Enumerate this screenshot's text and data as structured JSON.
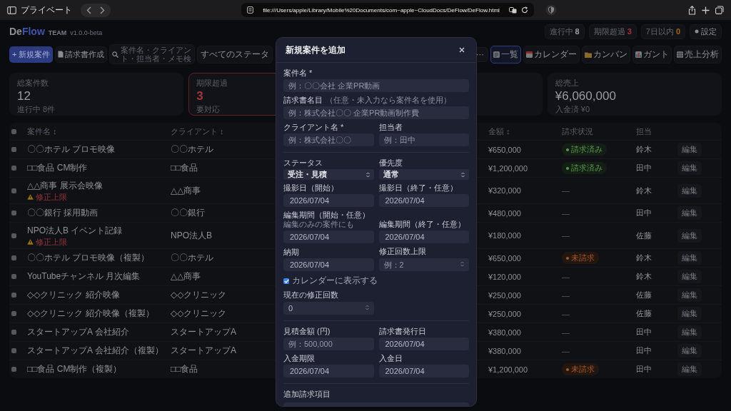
{
  "browser": {
    "private_label": "プライベート",
    "url": "file:///Users/apple/Library/Mobile%20Documents/com~apple~CloudDocs/DeFlow/DeFlow.html"
  },
  "header": {
    "logo_first": "De",
    "logo_second": "Flow",
    "team": "TEAM",
    "version": "v1.0.0-beta",
    "chips": [
      {
        "label": "進行中",
        "count": "8",
        "color": "#9a9ca2"
      },
      {
        "label": "期限超過",
        "count": "3",
        "color": "#a3353a"
      },
      {
        "label": "7日以内",
        "count": "0",
        "color": "#a06a14"
      }
    ],
    "settings": "設定"
  },
  "toolbar": {
    "new_button": "+ 新規案件",
    "invoice_button": "請求書作成",
    "search": {
      "placeholder": "案件名・クライアント・担当者・メモ検"
    },
    "status_select": "すべてのステータ",
    "more": "⋯",
    "views": [
      {
        "kind": "list",
        "label": "一覧",
        "selected": true
      },
      {
        "kind": "calendar",
        "label": "カレンダー",
        "selected": false
      },
      {
        "kind": "kanban",
        "label": "カンバン",
        "selected": false
      },
      {
        "kind": "gantt",
        "label": "ガント",
        "selected": false
      },
      {
        "kind": "sales",
        "label": "売上分析",
        "selected": false
      }
    ]
  },
  "stats": [
    {
      "label": "総案件数",
      "value": "12",
      "sub": "進行中 8件",
      "alert": false
    },
    {
      "label": "期限超過",
      "value": "3",
      "sub": "要対応",
      "alert": true
    },
    {
      "alert": false
    },
    {
      "label": "総売上",
      "value": "¥6,060,000",
      "sub": "入金済 ¥0",
      "alert": false
    }
  ],
  "table": {
    "header_checked": false,
    "columns": [
      {
        "label": "案件名",
        "sort": "↕"
      },
      {
        "label": "クライアント",
        "sort": "↕"
      },
      {
        "label": "金額",
        "sort": "↕"
      },
      {
        "label": "請求状況"
      },
      {
        "label": "担当"
      }
    ],
    "rows": [
      {
        "checked": false,
        "name": "〇〇ホテル プロモ映像",
        "client": "〇〇ホテル",
        "amount": "¥650,000",
        "billing": {
          "kind": "billed",
          "label": "請求済み"
        },
        "assignee": "鈴木",
        "edit": "編集"
      },
      {
        "checked": false,
        "name": "□□食品 CM制作",
        "client": "□□食品",
        "amount": "¥1,200,000",
        "billing": {
          "kind": "billed",
          "label": "請求済み"
        },
        "assignee": "田中",
        "edit": "編集"
      },
      {
        "checked": false,
        "name": "△△商事 展示会映像",
        "warning": "修正上限",
        "client": "△△商事",
        "amount": "¥320,000",
        "billing": {
          "kind": "none",
          "label": "—"
        },
        "assignee": "鈴木",
        "edit": "編集"
      },
      {
        "checked": false,
        "name": "〇〇銀行 採用動画",
        "client": "〇〇銀行",
        "amount": "¥480,000",
        "billing": {
          "kind": "none",
          "label": "—"
        },
        "assignee": "田中",
        "edit": "編集"
      },
      {
        "checked": false,
        "name": "NPO法人B イベント記録",
        "warning": "修正上限",
        "client": "NPO法人B",
        "amount": "¥180,000",
        "billing": {
          "kind": "none",
          "label": "—"
        },
        "assignee": "佐藤",
        "edit": "編集"
      },
      {
        "checked": false,
        "name": "〇〇ホテル プロモ映像（複製）",
        "client": "〇〇ホテル",
        "amount": "¥650,000",
        "billing": {
          "kind": "unbilled",
          "label": "未請求"
        },
        "assignee": "鈴木",
        "edit": "編集"
      },
      {
        "checked": false,
        "name": "YouTubeチャンネル 月次編集",
        "client": "△△商事",
        "amount": "¥120,000",
        "billing": {
          "kind": "none",
          "label": "—"
        },
        "assignee": "鈴木",
        "edit": "編集"
      },
      {
        "checked": false,
        "name": "◇◇クリニック 紹介映像",
        "client": "◇◇クリニック",
        "amount": "¥250,000",
        "billing": {
          "kind": "none",
          "label": "—"
        },
        "assignee": "佐藤",
        "edit": "編集"
      },
      {
        "checked": false,
        "name": "◇◇クリニック 紹介映像（複製）",
        "client": "◇◇クリニック",
        "amount": "¥250,000",
        "billing": {
          "kind": "none",
          "label": "—"
        },
        "assignee": "佐藤",
        "edit": "編集"
      },
      {
        "checked": false,
        "name": "スタートアップA 会社紹介",
        "client": "スタートアップA",
        "amount": "¥380,000",
        "billing": {
          "kind": "none",
          "label": "—"
        },
        "assignee": "田中",
        "edit": "編集"
      },
      {
        "checked": false,
        "name": "スタートアップA 会社紹介（複製）",
        "client": "スタートアップA",
        "amount": "¥380,000",
        "billing": {
          "kind": "none",
          "label": "—"
        },
        "assignee": "田中",
        "edit": "編集"
      },
      {
        "checked": false,
        "name": "□□食品 CM制作（複製）",
        "client": "□□食品",
        "amount": "¥1,200,000",
        "billing": {
          "kind": "unbilled",
          "label": "未請求"
        },
        "assignee": "田中",
        "edit": "編集"
      }
    ]
  },
  "modal": {
    "title": "新規案件を追加",
    "items": [
      {
        "kind": "wide_row",
        "fields": [
          {
            "kind": "text",
            "label": "案件名 *",
            "placeholder": "例：〇〇会社 企業PR動画"
          }
        ]
      },
      {
        "kind": "wide_row",
        "fields": [
          {
            "kind": "text",
            "label": "請求書名目",
            "note": "（任意・未入力なら案件名を使用）",
            "placeholder": "例：株式会社〇〇 企業PR動画制作費"
          }
        ]
      },
      {
        "kind": "row",
        "fields": [
          {
            "kind": "text",
            "label": "クライアント名 *",
            "placeholder": "例：株式会社〇〇"
          },
          {
            "kind": "text",
            "label": "担当者",
            "placeholder": "例：田中"
          }
        ]
      },
      {
        "kind": "divider"
      },
      {
        "kind": "row",
        "fields": [
          {
            "kind": "select",
            "label": "ステータス",
            "value": "受注・見積"
          },
          {
            "kind": "select",
            "label": "優先度",
            "value": "通常"
          }
        ]
      },
      {
        "kind": "row",
        "fields": [
          {
            "kind": "date",
            "label": "撮影日（開始）",
            "value": "2026/07/04"
          },
          {
            "kind": "date",
            "label": "撮影日（終了・任意）",
            "value": "2026/07/04"
          }
        ]
      },
      {
        "kind": "row",
        "fields": [
          {
            "kind": "date",
            "label": "編集期間（開始・任意）",
            "note": "編集のみの案件にも",
            "value": "2026/07/04"
          },
          {
            "kind": "date",
            "label": "編集期間（終了・任意）",
            "value": "2026/07/04"
          }
        ]
      },
      {
        "kind": "row",
        "fields": [
          {
            "kind": "date",
            "label": "納期",
            "value": "2026/07/04"
          },
          {
            "kind": "number",
            "label": "修正回数上限",
            "placeholder": "例：2"
          }
        ]
      },
      {
        "kind": "check",
        "label": "カレンダーに表示する",
        "checked": true
      },
      {
        "kind": "row",
        "fields": [
          {
            "kind": "number",
            "label": "現在の修正回数",
            "value": "0"
          }
        ]
      },
      {
        "kind": "divider"
      },
      {
        "kind": "row",
        "fields": [
          {
            "kind": "text",
            "label": "見積金額 (円)",
            "placeholder": "例：500,000"
          },
          {
            "kind": "date",
            "label": "請求書発行日",
            "value": "2026/07/04"
          }
        ]
      },
      {
        "kind": "row",
        "fields": [
          {
            "kind": "date",
            "label": "入金期限",
            "value": "2026/07/04"
          },
          {
            "kind": "date",
            "label": "入金日",
            "value": "2026/07/04"
          }
        ]
      },
      {
        "kind": "divider"
      },
      {
        "kind": "heading",
        "label": "追加請求項目"
      }
    ]
  }
}
